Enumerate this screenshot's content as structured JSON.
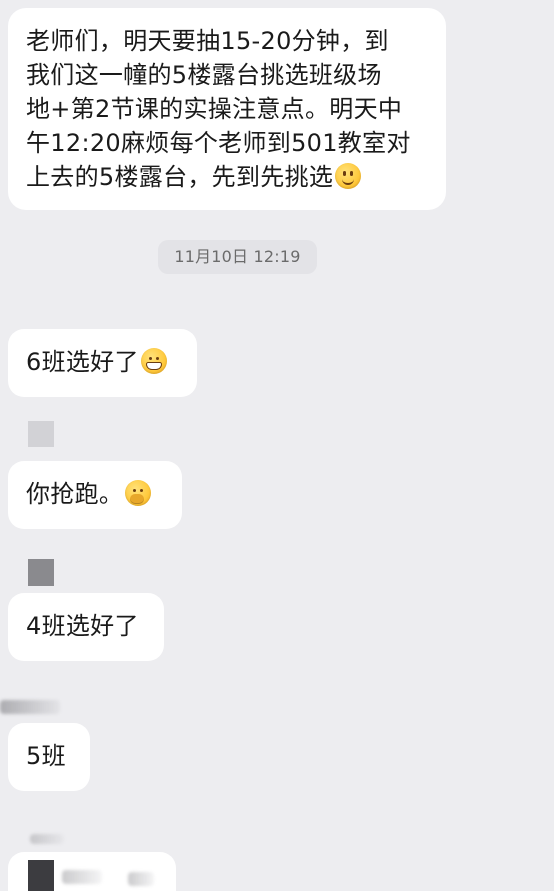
{
  "chat": {
    "messages": [
      {
        "text": "老师们，明天要抽15-20分钟，到\n我们这一幢的5楼露台挑选班级场\n地+第2节课的实操注意点。明天中\n午12:20麻烦每个老师到501教室对\n上去的5楼露台，先到先挑选",
        "emoji": "slightly-smiling-face"
      },
      {
        "text": "6班选好了",
        "emoji": "grinning-face"
      },
      {
        "text": "你抢跑。",
        "emoji": "face-with-hand-over-mouth"
      },
      {
        "text": "4班选好了"
      },
      {
        "text": "5班"
      }
    ],
    "timestamp": "11月10日 12:19"
  }
}
